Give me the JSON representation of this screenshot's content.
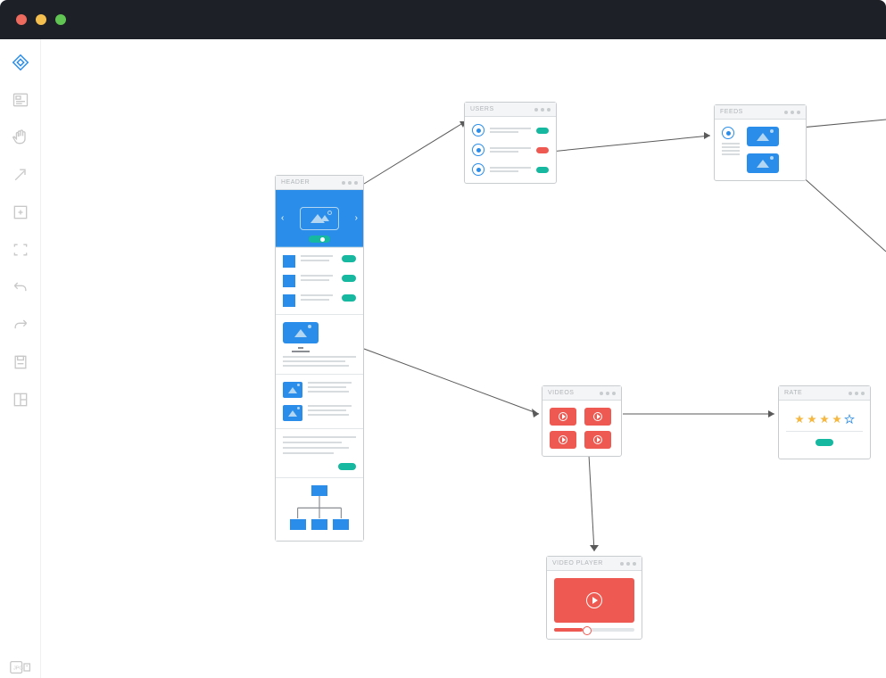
{
  "cards": {
    "header": {
      "title": "HEADER"
    },
    "users": {
      "title": "USERS"
    },
    "feeds": {
      "title": "FEEDS"
    },
    "videos": {
      "title": "VIDEOS"
    },
    "rate": {
      "title": "RATE",
      "stars_filled": 4,
      "stars_total": 5
    },
    "player": {
      "title": "VIDEO PLAYER"
    }
  },
  "colors": {
    "primary": "#2a8de9",
    "accent": "#16b8a0",
    "danger": "#ee5a52",
    "star": "#f5b842"
  }
}
